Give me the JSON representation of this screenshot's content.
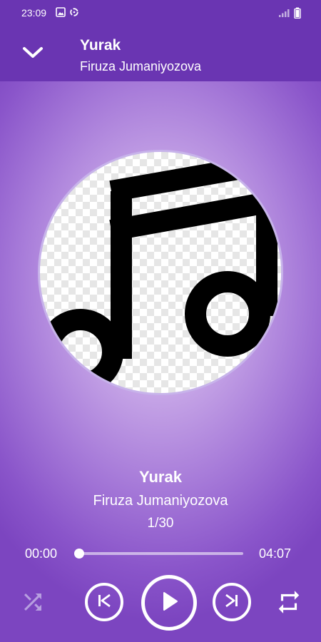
{
  "status_bar": {
    "time": "23:09",
    "icons_left": [
      "image-icon",
      "sync-icon"
    ],
    "icons_right": [
      "signal-icon",
      "battery-icon"
    ]
  },
  "header": {
    "collapse_icon": "chevron-down-icon",
    "title": "Yurak",
    "artist": "Firuza Jumaniyozova"
  },
  "artwork": {
    "icon": "music-note-icon"
  },
  "now_playing": {
    "title": "Yurak",
    "artist": "Firuza Jumaniyozova",
    "position": "1/30"
  },
  "progress": {
    "elapsed": "00:00",
    "total": "04:07",
    "fraction": 0.0
  },
  "controls": {
    "shuffle_icon": "shuffle-icon",
    "prev_icon": "skip-previous-icon",
    "play_icon": "play-icon",
    "next_icon": "skip-next-icon",
    "repeat_icon": "repeat-icon",
    "shuffle_enabled": false
  },
  "colors": {
    "header_bg": "#6a35b2",
    "accent": "#8a55ca"
  }
}
